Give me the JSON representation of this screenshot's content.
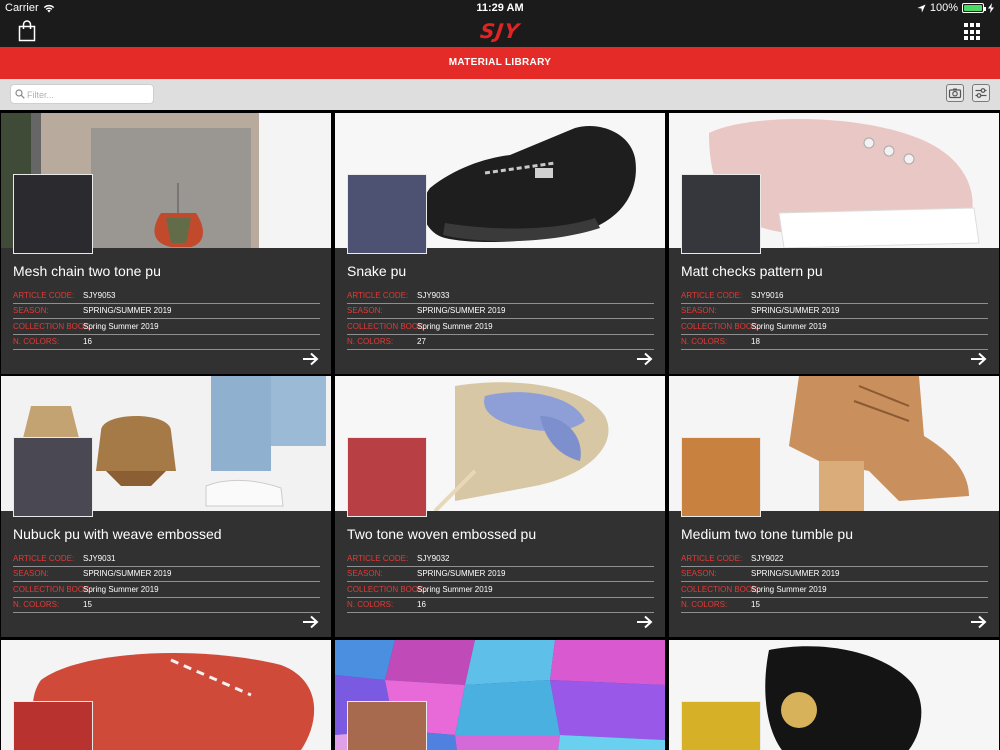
{
  "status_bar": {
    "carrier": "Carrier",
    "time": "11:29 AM",
    "battery": "100%"
  },
  "nav": {
    "logo": "SJY"
  },
  "title_bar": {
    "title": "MATERIAL LIBRARY"
  },
  "filter": {
    "placeholder": "Filter..."
  },
  "field_labels": {
    "article_code": "ARTICLE CODE:",
    "season": "SEASON:",
    "collection_book": "COLLECTION BOOK:",
    "n_colors": "N. COLORS:"
  },
  "cards": [
    {
      "title": "Mesh chain two tone pu",
      "article_code": "SJY9053",
      "season": "SPRING/SUMMER 2019",
      "collection_book": "Spring Summer 2019",
      "n_colors": "16",
      "swatch_color": "#2b2a2f",
      "image": "interior-lamp"
    },
    {
      "title": "Snake pu",
      "article_code": "SJY9033",
      "season": "SPRING/SUMMER 2019",
      "collection_book": "Spring Summer 2019",
      "n_colors": "27",
      "swatch_color": "#4d5272",
      "image": "black-loafer"
    },
    {
      "title": "Matt checks pattern pu",
      "article_code": "SJY9016",
      "season": "SPRING/SUMMER 2019",
      "collection_book": "Spring Summer 2019",
      "n_colors": "18",
      "swatch_color": "#36363d",
      "image": "pink-sneaker"
    },
    {
      "title": "Nubuck pu with weave embossed",
      "article_code": "SJY9031",
      "season": "SPRING/SUMMER 2019",
      "collection_book": "Spring Summer 2019",
      "n_colors": "15",
      "swatch_color": "#4a4852",
      "image": "lamps-jeans"
    },
    {
      "title": "Two tone woven embossed pu",
      "article_code": "SJY9032",
      "season": "SPRING/SUMMER 2019",
      "collection_book": "Spring Summer 2019",
      "n_colors": "16",
      "swatch_color": "#b84045",
      "image": "bow-heel"
    },
    {
      "title": "Medium two tone tumble pu",
      "article_code": "SJY9022",
      "season": "SPRING/SUMMER 2019",
      "collection_book": "Spring Summer 2019",
      "n_colors": "15",
      "swatch_color": "#c8813f",
      "image": "tan-boot"
    },
    {
      "title": "",
      "article_code": "",
      "season": "",
      "collection_book": "",
      "n_colors": "",
      "swatch_color": "#b8322f",
      "image": "red-oxford"
    },
    {
      "title": "",
      "article_code": "",
      "season": "",
      "collection_book": "",
      "n_colors": "",
      "swatch_color": "#a86a4e",
      "image": "stained-glass"
    },
    {
      "title": "",
      "article_code": "",
      "season": "",
      "collection_book": "",
      "n_colors": "",
      "swatch_color": "#d6b027",
      "image": "black-heel"
    }
  ],
  "colors": {
    "accent": "#e42b27",
    "card_bg": "#313131",
    "label_red": "#e53935"
  }
}
